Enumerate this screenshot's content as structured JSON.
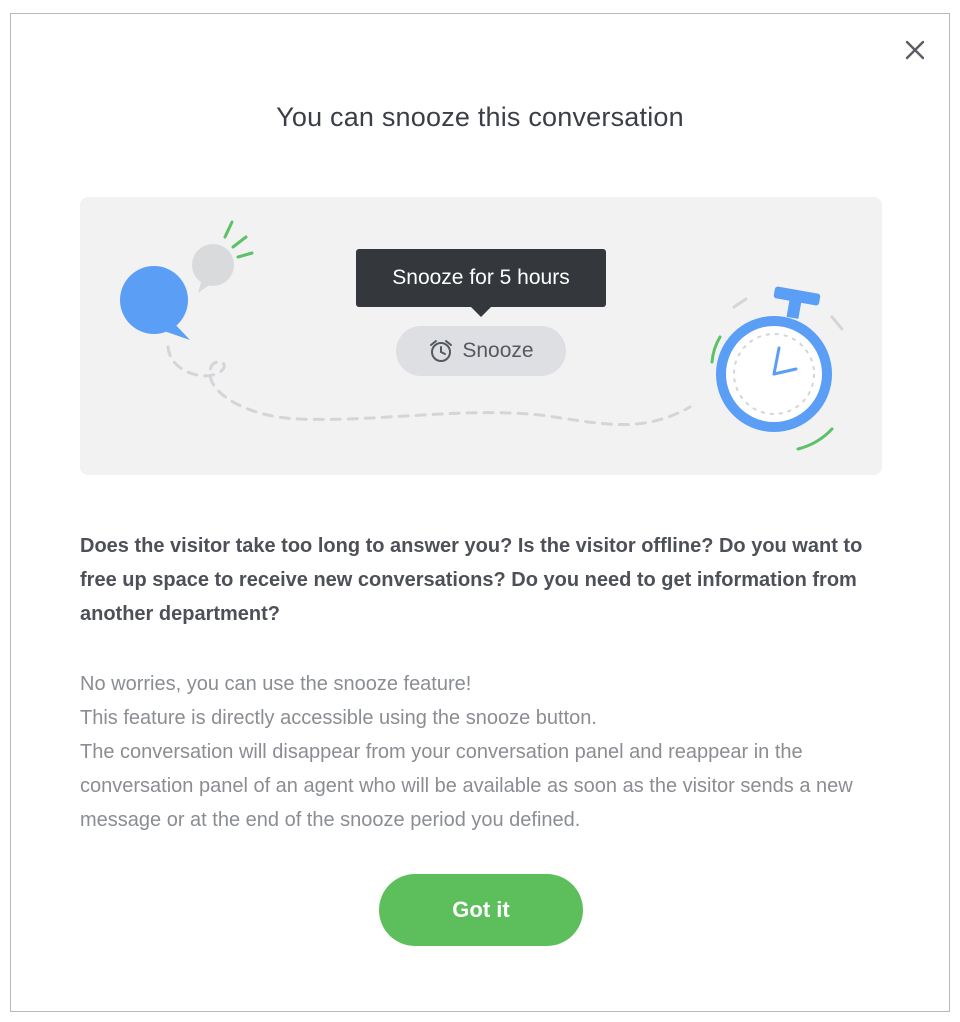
{
  "modal": {
    "title": "You can snooze this conversation",
    "close_icon": "close-icon"
  },
  "illustration": {
    "tooltip_text": "Snooze for 5 hours",
    "snooze_button_label": "Snooze",
    "snooze_icon": "alarm-clock-icon",
    "colors": {
      "chat_bubble": "#5b9ef5",
      "stopwatch": "#5b9ef5",
      "accent": "#5cc167",
      "background": "#f2f2f3"
    }
  },
  "question_text": "Does the visitor take too long to answer you? Is the visitor offline? Do you want to free up space to receive new conversations? Do you need to get information from another department?",
  "info_lines": [
    "No worries, you can use the snooze feature!",
    "This feature is directly accessible using the snooze button.",
    "The conversation will disappear from your conversation panel and reappear in the conversation panel of an agent who will be available as soon as the visitor sends a new message or at the end of the snooze period you defined."
  ],
  "got_it_button": {
    "label": "Got it",
    "color": "#5cbf5c"
  }
}
